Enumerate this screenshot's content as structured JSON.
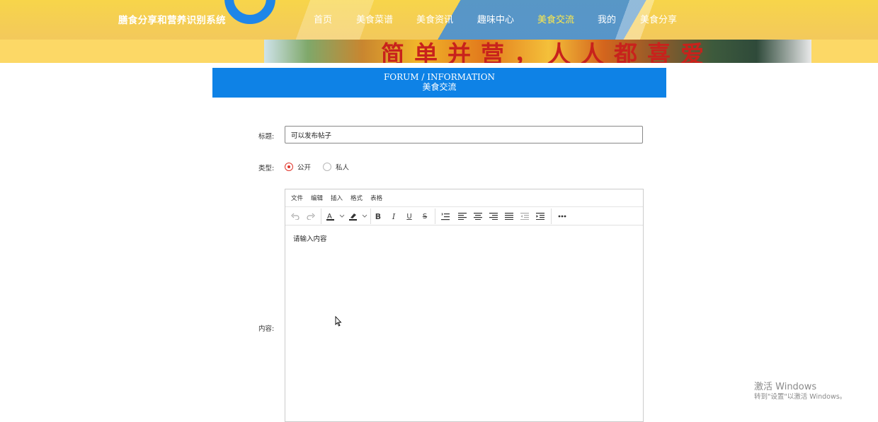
{
  "header": {
    "site_title": "膳食分享和营养识别系统",
    "banner_text": "简单并营，人人都喜爱",
    "nav": [
      "首页",
      "美食菜谱",
      "美食资讯",
      "趣味中心",
      "美食交流",
      "我的",
      "美食分享"
    ],
    "active_nav": "美食交流",
    "accent_color": "#1f86e8",
    "active_color": "#ffe94a"
  },
  "section": {
    "title_en": "FORUM / INFORMATION",
    "title_cn": "美食交流",
    "color": "#0e82e6"
  },
  "form": {
    "title_label": "标题:",
    "title_value": "可以发布帖子",
    "type_label": "类型:",
    "type_options": [
      "公开",
      "私人"
    ],
    "type_selected": "公开",
    "content_label": "内容:"
  },
  "editor": {
    "menu": [
      "文件",
      "编辑",
      "插入",
      "格式",
      "表格"
    ],
    "toolbar_icons": [
      "undo-icon",
      "redo-icon",
      "font-color-icon",
      "highlight-color-icon",
      "bold-icon",
      "italic-icon",
      "underline-icon",
      "strikethrough-icon",
      "line-height-icon",
      "align-left-icon",
      "align-center-icon",
      "align-right-icon",
      "align-justify-icon",
      "outdent-icon",
      "indent-icon",
      "more-icon"
    ],
    "placeholder": "请输入内容"
  },
  "watermark": {
    "line1": "激活 Windows",
    "line2": "转到\"设置\"以激活 Windows。"
  }
}
